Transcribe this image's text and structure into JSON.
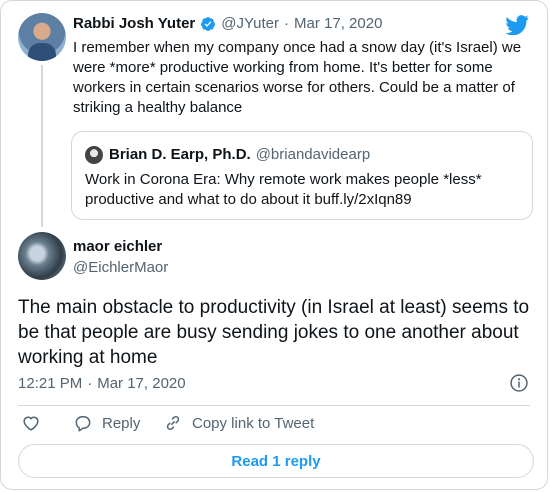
{
  "parent_tweet": {
    "display_name": "Rabbi Josh Yuter",
    "handle": "@JYuter",
    "separator": "·",
    "date": "Mar 17, 2020",
    "text": "I remember when my company once had a snow day (it's Israel) we were *more* productive working from home. It's better for some workers in certain scenarios worse for others. Could be a matter of striking a healthy balance"
  },
  "quoted_tweet": {
    "display_name": "Brian D. Earp, Ph.D.",
    "handle": "@briandavidearp",
    "text": "Work in Corona Era: Why remote work makes people *less* productive and what to do about it buff.ly/2xIqn89"
  },
  "main_tweet": {
    "display_name": "maor eichler",
    "handle": "@EichlerMaor",
    "text": "The main obstacle to productivity (in Israel at least) seems to be that people are busy sending jokes to one another about working at home",
    "time": "12:21 PM",
    "separator": "·",
    "date": "Mar 17, 2020"
  },
  "actions": {
    "like_icon": "heart-icon",
    "reply_label": "Reply",
    "reply_icon": "speech-bubble-icon",
    "copy_label": "Copy link to Tweet",
    "copy_icon": "link-icon",
    "read_replies_label": "Read 1 reply"
  },
  "icons": {
    "logo": "twitter-bird-icon",
    "verified": "verified-badge-icon",
    "info": "info-icon"
  },
  "colors": {
    "accent": "#1d9bf0",
    "secondary_text": "#536471",
    "border": "#cfd9de"
  }
}
